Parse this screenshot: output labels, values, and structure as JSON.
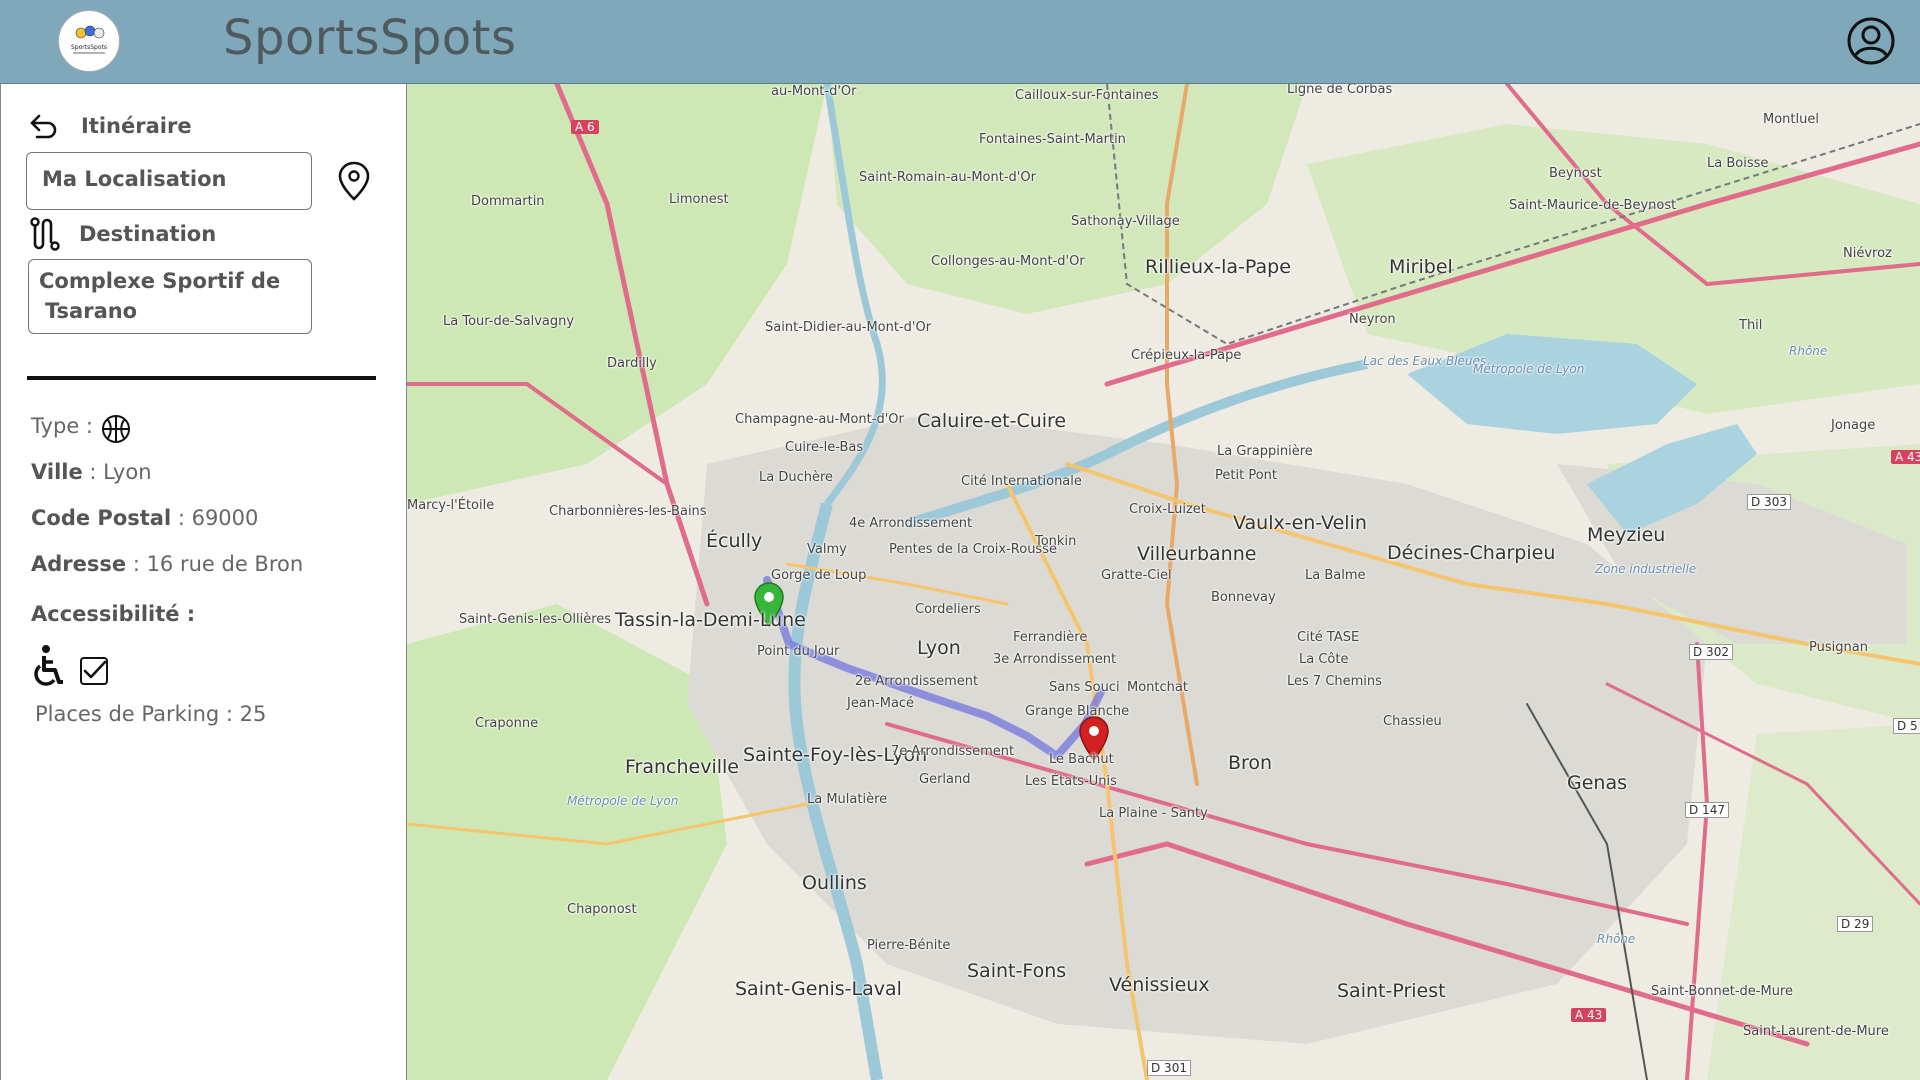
{
  "header": {
    "app_title": "SportsSpots",
    "logo_text": "SportsSpots",
    "profile_icon": "user-circle-icon"
  },
  "itinerary": {
    "back_icon": "back-arrow-icon",
    "label": "Itinéraire",
    "origin_value": "Ma Localisation",
    "location_pin_icon": "location-pin-icon",
    "destination_icon": "route-icon",
    "destination_label": "Destination",
    "destination_value_line1": "Complexe Sportif de",
    "destination_value_line2": "Tsarano"
  },
  "details": {
    "type_label": "Type :",
    "type_icon": "basketball-icon",
    "city_label": "Ville",
    "city_value": " : Lyon",
    "postal_label": "Code Postal",
    "postal_value": " : 69000",
    "address_label": "Adresse",
    "address_value": " : 16 rue de Bron",
    "accessibility_label": "Accessibilité :",
    "wheelchair_icon": "wheelchair-icon",
    "accessible_checked": true,
    "parking_text": "Places de Parking : 25"
  },
  "map": {
    "places_big": [
      "Lyon",
      "Villeurbanne",
      "Vaulx-en-Velin",
      "Décines-Charpieu",
      "Bron",
      "Meyzieu",
      "Caluire-et-Cuire",
      "Rillieux-la-Pape",
      "Miribel",
      "Écully",
      "Tassin-la-Demi-Lune",
      "Oullins",
      "Francheville",
      "Saint-Fons",
      "Vénissieux",
      "Saint-Priest",
      "Genas",
      "Sainte-Foy-lès-Lyon",
      "Saint-Genis-Laval"
    ],
    "places_small": [
      "au-Mont-d'Or",
      "Cailloux-sur-Fontaines",
      "Fontaines-Saint-Martin",
      "Montluel",
      "La Boisse",
      "Beynost",
      "Saint-Maurice-de-Beynost",
      "Dommartin",
      "Limonest",
      "Saint-Romain-au-Mont-d'Or",
      "Sathonay-Village",
      "Collonges-au-Mont-d'Or",
      "Neyron",
      "Niévroz",
      "Thil",
      "La Tour-de-Salvagny",
      "Dardilly",
      "Saint-Didier-au-Mont-d'Or",
      "Crépieux-la-Pape",
      "Champagne-au-Mont-d'Or",
      "Cuire-le-Bas",
      "La Grappinière",
      "Petit Pont",
      "Jonage",
      "Marcy-l'Étoile",
      "La Duchère",
      "Cité Internationale",
      "Charbonnières-les-Bains",
      "Croix-Luizet",
      "4e Arrondissement",
      "Pentes de la Croix-Rousse",
      "Tonkin",
      "Valmy",
      "Gratte-Ciel",
      "Gorge de Loup",
      "La Balme",
      "Bonnevay",
      "Saint-Genis-les-Ollières",
      "Cordeliers",
      "Ferrandière",
      "Cité TASE",
      "Point du Jour",
      "3e Arrondissement",
      "La Côte",
      "Les 7 Chemins",
      "2e Arrondissement",
      "Sans Souci",
      "Montchat",
      "Jean-Macé",
      "Grange Blanche",
      "Chassieu",
      "Craponne",
      "7e Arrondissement",
      "Le Bachut",
      "Gerland",
      "Les États-Unis",
      "La Mulatière",
      "La Plaine - Santy",
      "Pusignan",
      "Chaponost",
      "Pierre-Bénite",
      "Saint-Bonnet-de-Mure",
      "Saint-Laurent-de-Mure"
    ],
    "water_labels": [
      "Lac des Eaux Bleues",
      "Métropole de Lyon",
      "Rhône",
      "Zone industrielle",
      "Métropole de Lyon",
      "Rhône"
    ],
    "road_refs": [
      "A 6",
      "D 303",
      "D 302",
      "D 147",
      "D 29",
      "A 43",
      "D 301",
      "Ligne de Corbas",
      "A 43",
      "D 5"
    ],
    "start_marker_icon": "green-map-marker-icon",
    "end_marker_icon": "red-map-marker-icon"
  }
}
